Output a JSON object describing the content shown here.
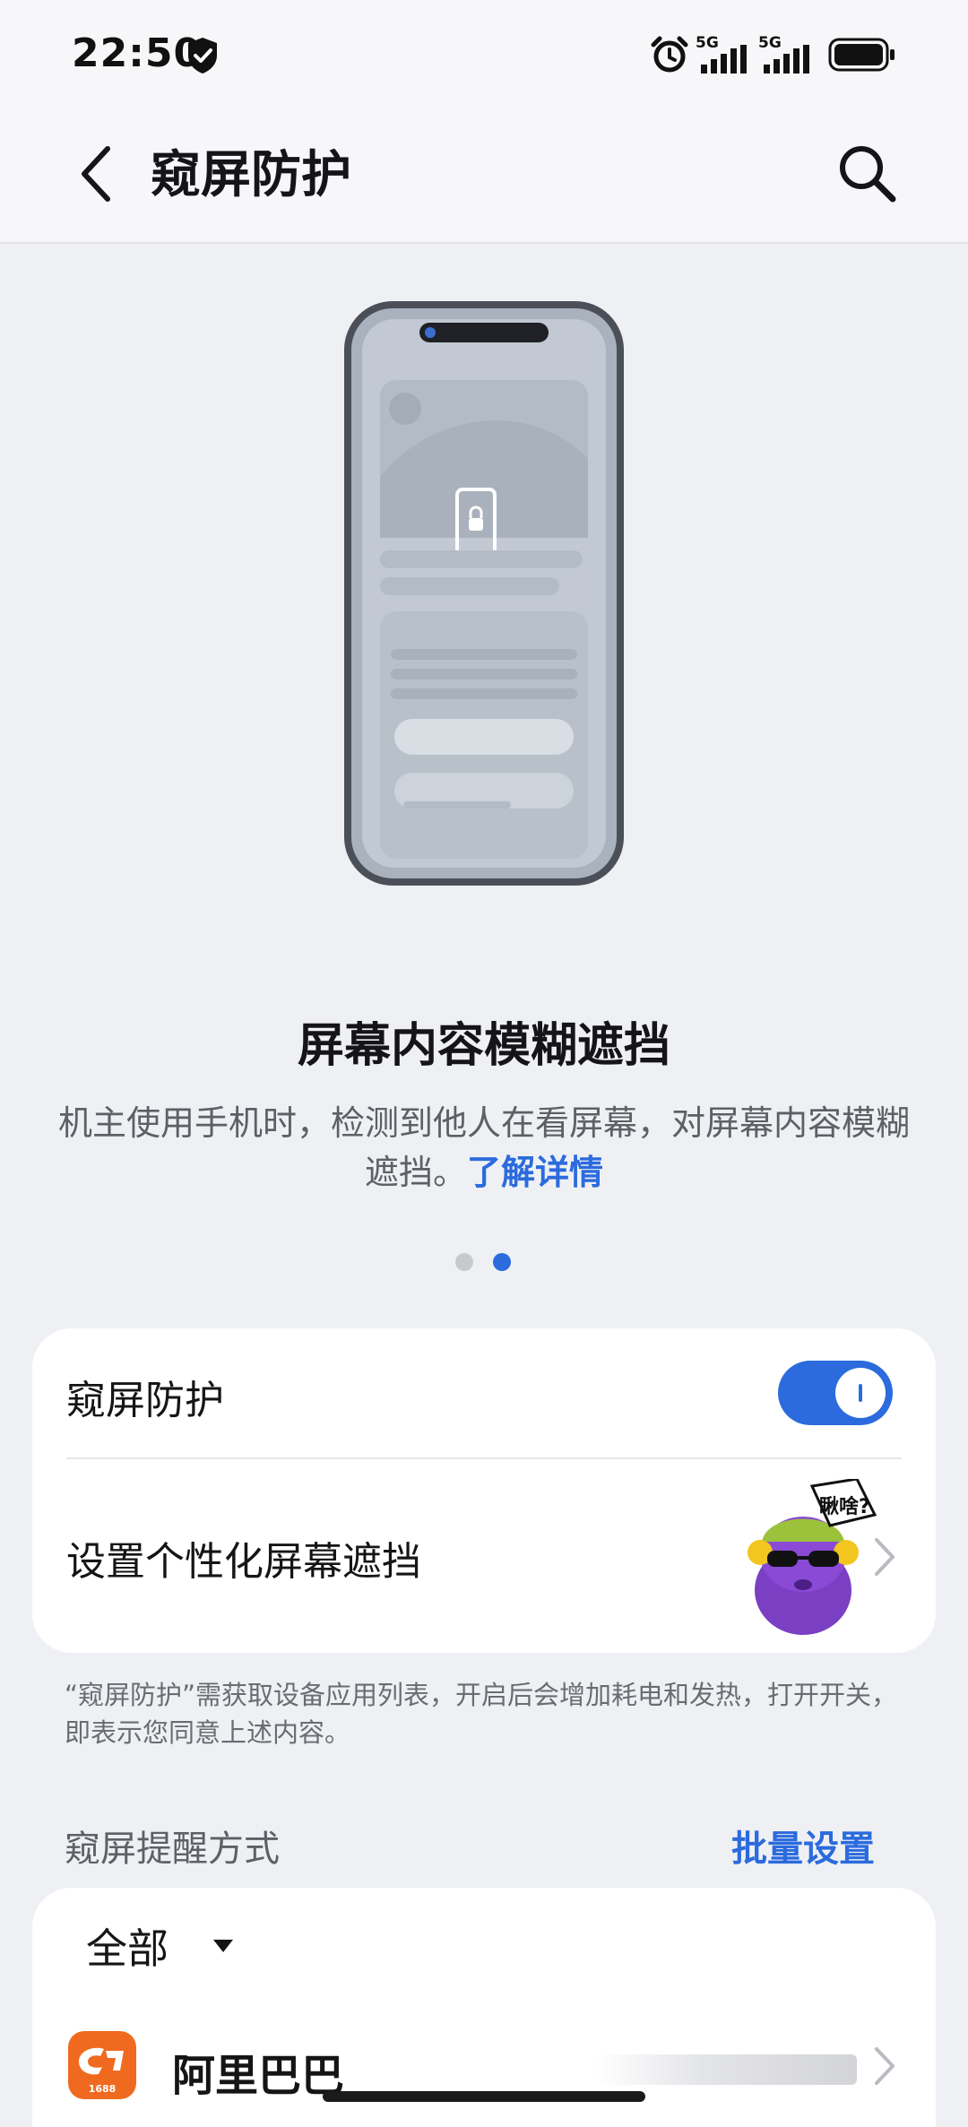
{
  "status_bar": {
    "time": "22:50",
    "network_1": "5G",
    "network_2": "5G",
    "icons": [
      "shield-check-icon",
      "alarm-icon",
      "signal-icon",
      "signal-icon",
      "battery-icon"
    ]
  },
  "header": {
    "title": "窥屏防护",
    "back_icon": "back-arrow-icon",
    "search_icon": "search-icon"
  },
  "feature": {
    "title": "屏幕内容模糊遮挡",
    "description": "机主使用手机时，检测到他人在看屏幕，对屏幕内容模糊遮挡。",
    "link": "了解详情",
    "pager": {
      "count": 2,
      "active": 2
    }
  },
  "settings_card": {
    "protection_label": "窥屏防护",
    "protection_enabled": true,
    "personalize_label": "设置个性化屏幕遮挡",
    "mascot_badge": "瞅啥?"
  },
  "note": "“窥屏防护”需获取设备应用列表，开启后会增加耗电和发热，打开开关，即表示您同意上述内容。",
  "reminder": {
    "section_title": "窥屏提醒方式",
    "batch_label": "批量设置",
    "filter_label": "全部",
    "apps": [
      {
        "name": "阿里巴巴",
        "icon_label": "1688"
      }
    ]
  },
  "colors": {
    "accent": "#2b6bdd",
    "background": "#eff0f4",
    "card": "#ffffff",
    "app_icon": "#ef6a1f"
  }
}
